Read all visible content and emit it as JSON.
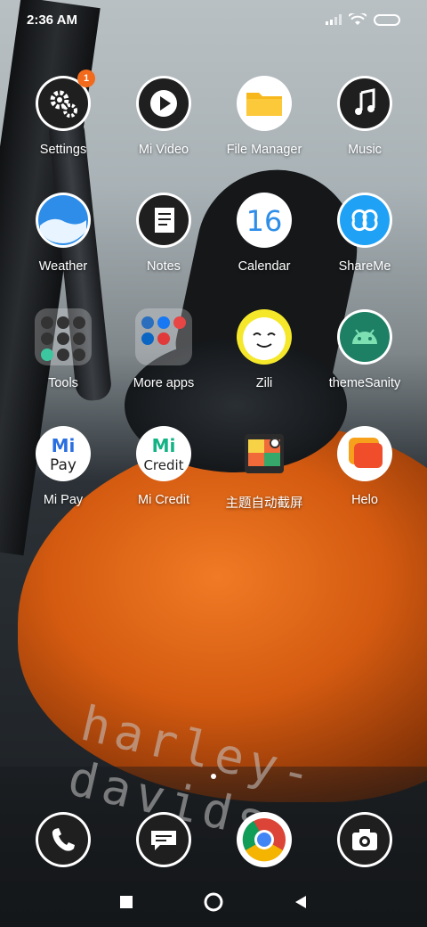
{
  "status_bar": {
    "time": "2:36 AM"
  },
  "apps": [
    {
      "label": "Settings",
      "icon": "gear-icon",
      "badge": "1"
    },
    {
      "label": "Mi Video",
      "icon": "play-icon"
    },
    {
      "label": "File Manager",
      "icon": "folder-icon"
    },
    {
      "label": "Music",
      "icon": "music-note-icon"
    },
    {
      "label": "Weather",
      "icon": "weather-icon"
    },
    {
      "label": "Notes",
      "icon": "notes-icon"
    },
    {
      "label": "Calendar",
      "icon": "calendar-icon",
      "day": "16"
    },
    {
      "label": "ShareMe",
      "icon": "infinity-icon"
    },
    {
      "label": "Tools",
      "icon": "tools-folder-icon"
    },
    {
      "label": "More apps",
      "icon": "apps-folder-icon"
    },
    {
      "label": "Zili",
      "icon": "zili-face-icon"
    },
    {
      "label": "themeSanity",
      "icon": "android-icon"
    },
    {
      "label": "Mi Pay",
      "icon": "mi-pay-icon",
      "logo_top": "Mi",
      "logo_bottom": "Pay"
    },
    {
      "label": "Mi Credit",
      "icon": "mi-credit-icon",
      "logo_top": "Mi",
      "logo_bottom": "Credit"
    },
    {
      "label": "主题自动截屏",
      "icon": "screenshot-picture-icon"
    },
    {
      "label": "Helo",
      "icon": "helo-chat-icon"
    }
  ],
  "dock": [
    {
      "icon": "phone-icon"
    },
    {
      "icon": "message-icon"
    },
    {
      "icon": "chrome-icon"
    },
    {
      "icon": "camera-icon"
    }
  ],
  "nav": [
    "recents-button",
    "home-button",
    "back-button"
  ],
  "wallpaper_text": "harley-davids"
}
